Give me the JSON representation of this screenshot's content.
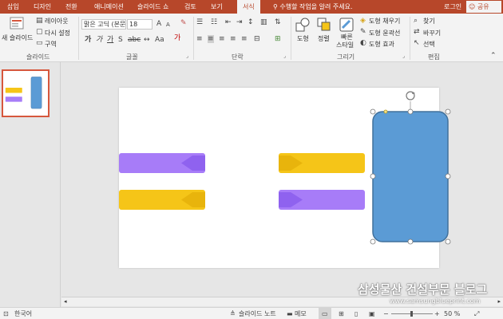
{
  "tabs": [
    {
      "label": "삽입",
      "active": false
    },
    {
      "label": "디자인",
      "active": false
    },
    {
      "label": "전환",
      "active": false
    },
    {
      "label": "애니메이션",
      "active": false
    },
    {
      "label": "슬라이드 쇼",
      "active": false
    },
    {
      "label": "검토",
      "active": false
    },
    {
      "label": "보기",
      "active": false
    },
    {
      "label": "서식",
      "active": true
    }
  ],
  "tell_me": "수행할 작업을 알려 주세요.",
  "login": "로그인",
  "share": "공유",
  "ribbon": {
    "slides": {
      "new_slide": "새 슬라이드",
      "layout": "레이아웃",
      "reset": "다시 설정",
      "section": "구역",
      "group_label": "슬라이드"
    },
    "font": {
      "font_name": "맑은 고딕 (본문)",
      "font_size": "18",
      "group_label": "글꼴"
    },
    "paragraph": {
      "group_label": "단락"
    },
    "drawing": {
      "shapes": "도형",
      "arrange": "정렬",
      "quick_styles_1": "빠른",
      "quick_styles_2": "스타일",
      "shape_fill": "도형 채우기",
      "shape_outline": "도형 윤곽선",
      "shape_effects": "도형 효과",
      "group_label": "그리기"
    },
    "editing": {
      "find": "찾기",
      "replace": "바꾸기",
      "select": "선택",
      "group_label": "편집"
    }
  },
  "thumbnail": {
    "number": "1"
  },
  "status": {
    "language": "한국어",
    "notes": "슬라이드 노트",
    "comments": "메모",
    "zoom": "50 %"
  },
  "watermark": {
    "title": "삼성물산 건설부문 블로그",
    "url": "www.samsungblueprint.com"
  },
  "colors": {
    "accent": "#b7472a",
    "purple": "#a77cf8",
    "purple_dark": "#8f62ef",
    "yellow": "#f5c518",
    "yellow_dark": "#e8b40c",
    "blue": "#5b9bd5",
    "blue_border": "#41719c"
  }
}
